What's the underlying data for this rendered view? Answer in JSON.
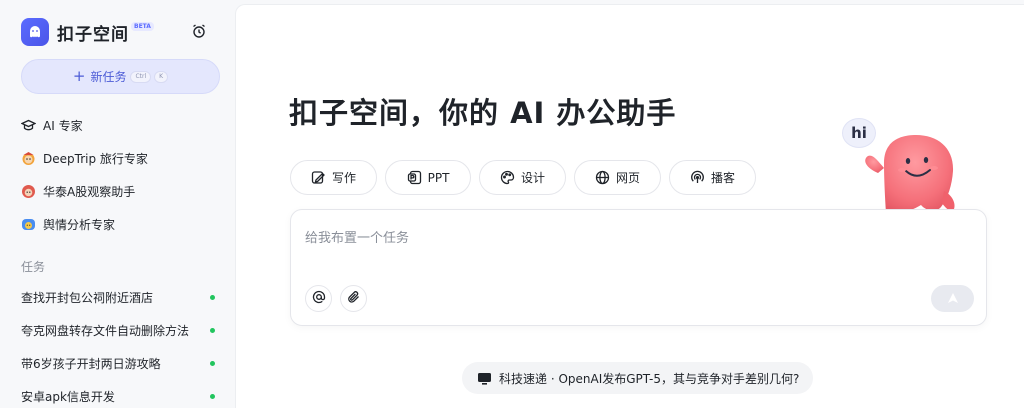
{
  "brand": {
    "name": "扣子空间",
    "badge": "BETA"
  },
  "sidebar": {
    "new_task": {
      "label": "新任务",
      "shortcut_ctrl": "Ctrl",
      "shortcut_key": "K"
    },
    "experts": [
      {
        "label": "AI 专家",
        "icon": "graduation-cap-icon"
      },
      {
        "label": "DeepTrip 旅行专家",
        "icon": "deeptrip-avatar-icon"
      },
      {
        "label": "华泰A股观察助手",
        "icon": "huatai-avatar-icon"
      },
      {
        "label": "舆情分析专家",
        "icon": "sentiment-avatar-icon"
      }
    ],
    "section_label": "任务",
    "tasks": [
      {
        "label": "查找开封包公祠附近酒店"
      },
      {
        "label": "夸克网盘转存文件自动删除方法"
      },
      {
        "label": "带6岁孩子开封两日游攻略"
      },
      {
        "label": "安卓apk信息开发"
      }
    ]
  },
  "main": {
    "headline": "扣子空间，你的 AI 办公助手",
    "chips": [
      {
        "label": "写作",
        "icon": "writing-icon"
      },
      {
        "label": "PPT",
        "icon": "ppt-icon"
      },
      {
        "label": "设计",
        "icon": "palette-icon"
      },
      {
        "label": "网页",
        "icon": "globe-icon"
      },
      {
        "label": "播客",
        "icon": "podcast-icon"
      }
    ],
    "composer": {
      "placeholder": "给我布置一个任务"
    },
    "news": {
      "text": "科技速递 · OpenAI发布GPT-5，其与竞争对手差别几何?"
    },
    "mascot": {
      "speech": "hi"
    }
  },
  "colors": {
    "accent": "#4b5bd6",
    "status_dot": "#22c55e"
  }
}
